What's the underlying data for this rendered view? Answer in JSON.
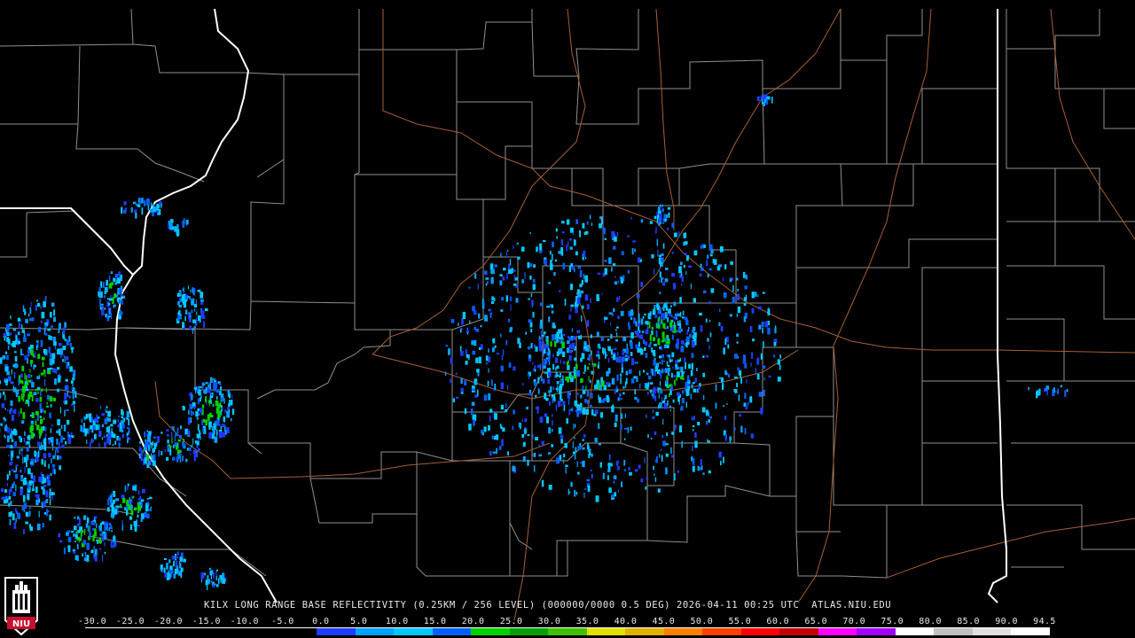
{
  "caption": "KILX LONG RANGE BASE REFLECTIVITY (0.25KM / 256 LEVEL) (000000/0000 0.5 DEG) 2026-04-11 00:25 UTC  ATLAS.NIU.EDU",
  "logo_text": "NIU",
  "scale": {
    "ticks": [
      "-30.0",
      "-25.0",
      "-20.0",
      "-15.0",
      "-10.0",
      "-5.0",
      "0.0",
      "5.0",
      "10.0",
      "15.0",
      "20.0",
      "25.0",
      "30.0",
      "35.0",
      "40.0",
      "45.0",
      "50.0",
      "55.0",
      "60.0",
      "65.0",
      "70.0",
      "75.0",
      "80.0",
      "85.0",
      "90.0",
      "94.5"
    ],
    "colors": [
      "#000000",
      "#000000",
      "#000000",
      "#000000",
      "#000000",
      "#000000",
      "#1e3cff",
      "#00a0ff",
      "#00c8ff",
      "#0060ff",
      "#00d000",
      "#00a000",
      "#40c000",
      "#e0e000",
      "#e0b000",
      "#ff8000",
      "#ff4000",
      "#ff0000",
      "#c00000",
      "#ff00ff",
      "#a000ff",
      "#ffffff",
      "#c0c0c0",
      "#e0e0e0",
      "#ffffff"
    ]
  },
  "map": {
    "county_line_color": "#9a9a9a",
    "highway_color": "#b06a3a",
    "state_line_color": "#ffffff"
  }
}
